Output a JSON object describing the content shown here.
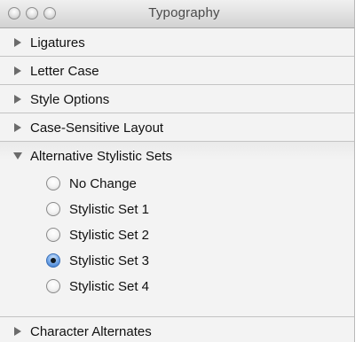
{
  "window": {
    "title": "Typography"
  },
  "sections": [
    {
      "label": "Ligatures",
      "expanded": false
    },
    {
      "label": "Letter Case",
      "expanded": false
    },
    {
      "label": "Style Options",
      "expanded": false
    },
    {
      "label": "Case-Sensitive Layout",
      "expanded": false
    },
    {
      "label": "Alternative Stylistic Sets",
      "expanded": true,
      "options": [
        {
          "label": "No Change",
          "selected": false
        },
        {
          "label": "Stylistic Set 1",
          "selected": false
        },
        {
          "label": "Stylistic Set 2",
          "selected": false
        },
        {
          "label": "Stylistic Set 3",
          "selected": true
        },
        {
          "label": "Stylistic Set 4",
          "selected": false
        }
      ]
    },
    {
      "label": "Character Alternates",
      "expanded": false
    }
  ],
  "colors": {
    "selected_radio": "#2e6fc7",
    "panel_background": "#f3f3f3"
  }
}
